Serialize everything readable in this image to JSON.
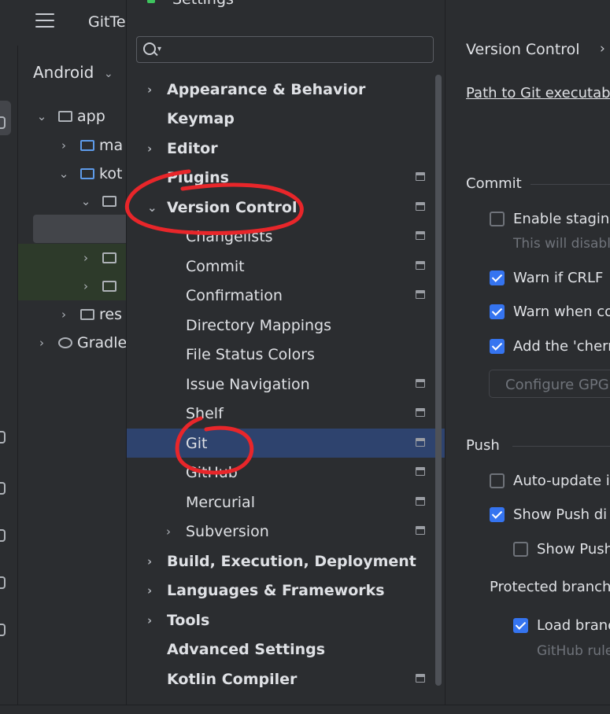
{
  "ide": {
    "project_name": "GitTe",
    "panel_title": "Android",
    "tree": [
      {
        "label": "app",
        "arrow": "⌄"
      },
      {
        "label": "ma",
        "arrow": "›"
      },
      {
        "label": "kot",
        "arrow": "⌄"
      },
      {
        "label": "",
        "arrow": "⌄"
      },
      {
        "label": "",
        "arrow": "›"
      },
      {
        "label": "",
        "arrow": "›"
      },
      {
        "label": "res",
        "arrow": "›"
      },
      {
        "label": "Gradle",
        "arrow": "›"
      }
    ]
  },
  "settings": {
    "window_title": "Settings",
    "search": {
      "placeholder": "",
      "value": ""
    },
    "nav": [
      {
        "label": "Appearance & Behavior",
        "arrow": "›"
      },
      {
        "label": "Keymap",
        "arrow": ""
      },
      {
        "label": "Editor",
        "arrow": "›"
      },
      {
        "label": "Plugins",
        "arrow": ""
      },
      {
        "label": "Version Control",
        "arrow": "⌄"
      },
      {
        "label": "Changelists",
        "arrow": ""
      },
      {
        "label": "Commit",
        "arrow": ""
      },
      {
        "label": "Confirmation",
        "arrow": ""
      },
      {
        "label": "Directory Mappings",
        "arrow": ""
      },
      {
        "label": "File Status Colors",
        "arrow": ""
      },
      {
        "label": "Issue Navigation",
        "arrow": ""
      },
      {
        "label": "Shelf",
        "arrow": ""
      },
      {
        "label": "Git",
        "arrow": ""
      },
      {
        "label": "GitHub",
        "arrow": ""
      },
      {
        "label": "Mercurial",
        "arrow": ""
      },
      {
        "label": "Subversion",
        "arrow": "›"
      },
      {
        "label": "Build, Execution, Deployment",
        "arrow": "›"
      },
      {
        "label": "Languages & Frameworks",
        "arrow": "›"
      },
      {
        "label": "Tools",
        "arrow": "›"
      },
      {
        "label": "Advanced Settings",
        "arrow": ""
      },
      {
        "label": "Kotlin Compiler",
        "arrow": ""
      }
    ],
    "selected_item": "Git",
    "panel": {
      "breadcrumb": "Version Control",
      "breadcrumb_sep": "›",
      "path_label": "Path to Git executab",
      "commit_section": "Commit",
      "enable_staging": "Enable stagin",
      "enable_staging_hint": "This will disable",
      "warn_crlf": "Warn if CRLF",
      "warn_when": "Warn when co",
      "add_cherry": "Add the 'cherr",
      "configure_gpg": "Configure GPG",
      "push_section": "Push",
      "auto_update": "Auto-update i",
      "show_push_dialog": "Show Push di",
      "show_push_sub": "Show Push",
      "protected_branches": "Protected branch",
      "load_branch": "Load branc",
      "github_rules": "GitHub rule"
    },
    "checkboxes": {
      "enable_staging": false,
      "warn_crlf": true,
      "warn_when": true,
      "add_cherry": true,
      "auto_update": false,
      "show_push_dialog": true,
      "show_push_sub": false,
      "load_branch": true
    },
    "colors": {
      "accent": "#3574f0",
      "selection": "#2e436e",
      "annotation": "#e8262a"
    }
  }
}
